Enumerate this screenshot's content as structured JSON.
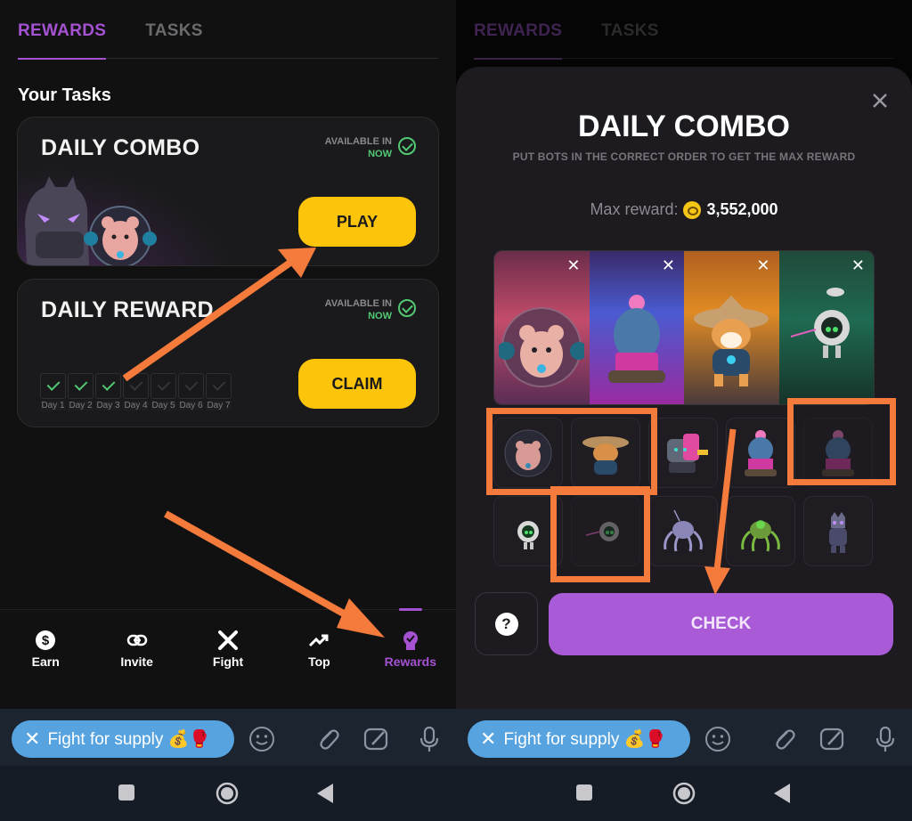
{
  "left": {
    "tabs": [
      {
        "label": "REWARDS",
        "active": true
      },
      {
        "label": "TASKS",
        "active": false
      }
    ],
    "section_title": "Your Tasks",
    "daily_combo": {
      "title": "DAILY COMBO",
      "available_label": "AVAILABLE IN",
      "available_value": "NOW",
      "button": "PLAY"
    },
    "daily_reward": {
      "title": "DAILY REWARD",
      "available_label": "AVAILABLE IN",
      "available_value": "NOW",
      "button": "CLAIM",
      "days": [
        {
          "label": "Day 1",
          "done": true
        },
        {
          "label": "Day 2",
          "done": true
        },
        {
          "label": "Day 3",
          "done": true
        },
        {
          "label": "Day 4",
          "done": false
        },
        {
          "label": "Day 5",
          "done": false
        },
        {
          "label": "Day 6",
          "done": false
        },
        {
          "label": "Day 7",
          "done": false
        }
      ]
    },
    "nav": [
      {
        "label": "Earn",
        "icon": "dollar-icon"
      },
      {
        "label": "Invite",
        "icon": "link-icon"
      },
      {
        "label": "Fight",
        "icon": "swords-icon"
      },
      {
        "label": "Top",
        "icon": "trending-up-icon"
      },
      {
        "label": "Rewards",
        "icon": "badge-icon",
        "active": true
      }
    ]
  },
  "right": {
    "tabs": [
      {
        "label": "REWARDS",
        "active": true
      },
      {
        "label": "TASKS",
        "active": false
      }
    ],
    "modal": {
      "title": "DAILY COMBO",
      "subtitle": "PUT BOTS IN THE CORRECT ORDER TO GET THE MAX REWARD",
      "max_reward_label": "Max reward:",
      "max_reward_value": "3,552,000",
      "slots": [
        "hamster-bot",
        "cactus-tank-bot",
        "shiba-hat-bot",
        "drone-bot"
      ],
      "grid": [
        "hamster-bot",
        "shiba-hat-bot",
        "nyan-cat-bot",
        "cactus-tank-bot",
        "cactus-tank-bot-dim",
        "drone-bot",
        "drone-bot-dim",
        "spider-bot-purple",
        "spider-bot-green",
        "panther-bot"
      ],
      "check_button": "CHECK",
      "help_button": "?"
    }
  },
  "telegram": {
    "pill_label": "Fight for supply 💰🥊"
  },
  "colors": {
    "accent_purple": "#a452d1",
    "yellow": "#fcc40a",
    "success_green": "#52c873",
    "annotation_orange": "#f47b3b",
    "telegram_blue": "#56a3e0"
  }
}
